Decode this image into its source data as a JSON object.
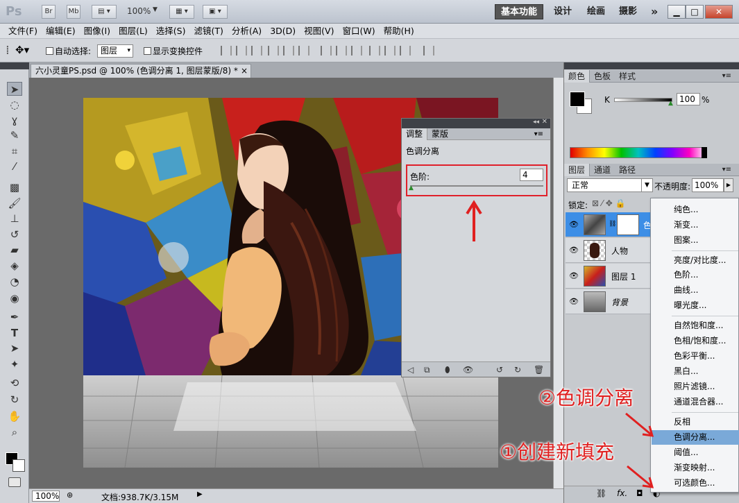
{
  "titlebar": {
    "app_logo": "Ps",
    "bridge_btn": "Br",
    "minibridge_btn": "Mb",
    "zoom": "100%",
    "workspaces": [
      "基本功能",
      "设计",
      "绘画",
      "摄影"
    ],
    "more": "»"
  },
  "menubar": {
    "items": [
      "文件(F)",
      "编辑(E)",
      "图像(I)",
      "图层(L)",
      "选择(S)",
      "滤镜(T)",
      "分析(A)",
      "3D(D)",
      "视图(V)",
      "窗口(W)",
      "帮助(H)"
    ]
  },
  "options": {
    "auto_select_label": "自动选择:",
    "auto_select_value": "图层",
    "show_transform_label": "显示变换控件"
  },
  "document": {
    "tab_title": "六小灵童PS.psd @ 100% (色调分离 1, 图层蒙版/8) *",
    "close": "×",
    "status_zoom": "100%",
    "status_doc": "文档:938.7K/3.15M"
  },
  "adjust_panel": {
    "tabs": [
      "调整",
      "蒙版"
    ],
    "title": "色调分离",
    "levels_label": "色阶:",
    "levels_value": "4"
  },
  "color_panel": {
    "tabs": [
      "颜色",
      "色板",
      "样式"
    ],
    "channel": "K",
    "value": "100",
    "unit": "%"
  },
  "layers_panel": {
    "tabs": [
      "图层",
      "通道",
      "路径"
    ],
    "blend_mode": "正常",
    "opacity_label": "不透明度:",
    "opacity_value": "100%",
    "lock_label": "锁定:",
    "layers": [
      {
        "name": "色",
        "selected": true
      },
      {
        "name": "人物",
        "selected": false
      },
      {
        "name": "图层 1",
        "selected": false
      },
      {
        "name": "背景",
        "selected": false
      }
    ]
  },
  "context_menu": {
    "groups": [
      [
        "纯色...",
        "渐变...",
        "图案..."
      ],
      [
        "亮度/对比度...",
        "色阶...",
        "曲线...",
        "曝光度..."
      ],
      [
        "自然饱和度...",
        "色相/饱和度...",
        "色彩平衡...",
        "黑白...",
        "照片滤镜...",
        "通道混合器..."
      ],
      [
        "反相",
        "色调分离...",
        "阈值...",
        "渐变映射...",
        "可选颜色..."
      ]
    ],
    "highlighted": "色调分离..."
  },
  "annotations": {
    "step1": "①创建新填充",
    "step2": "②色调分离"
  },
  "colors": {
    "highlight_red": "#e02020",
    "menu_highlight": "#7aa9d8",
    "layer_selected": "#3d8ee6"
  }
}
